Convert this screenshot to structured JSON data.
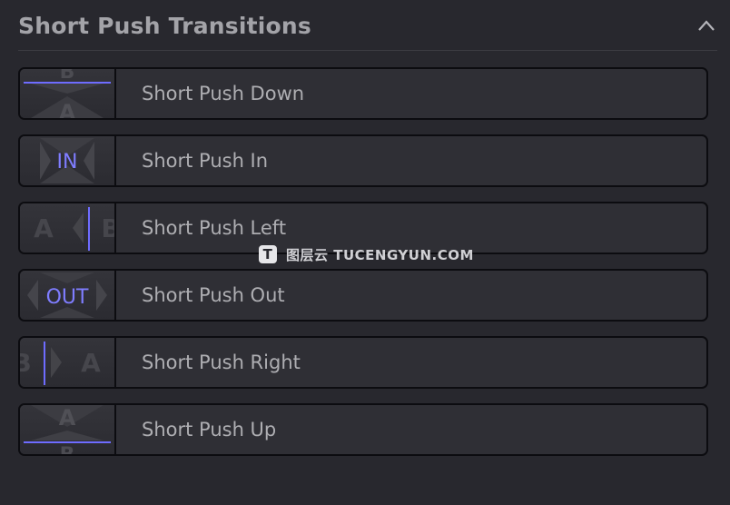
{
  "panel": {
    "title": "Short Push Transitions",
    "collapse_icon": "chevron-up-icon"
  },
  "items": [
    {
      "label": "Short Push Down",
      "thumb_icon": "short-push-down-thumbnail"
    },
    {
      "label": "Short Push In",
      "thumb_icon": "short-push-in-thumbnail",
      "thumb_text": "IN"
    },
    {
      "label": "Short Push Left",
      "thumb_icon": "short-push-left-thumbnail"
    },
    {
      "label": "Short Push Out",
      "thumb_icon": "short-push-out-thumbnail",
      "thumb_text": "OUT"
    },
    {
      "label": "Short Push Right",
      "thumb_icon": "short-push-right-thumbnail"
    },
    {
      "label": "Short Push Up",
      "thumb_icon": "short-push-up-thumbnail"
    }
  ],
  "watermark": {
    "logo": "T",
    "text": "图层云  TUCENGYUN.COM"
  },
  "colors": {
    "accent": "#6e6cff",
    "background": "#28282e",
    "row": "#2f2f35"
  }
}
